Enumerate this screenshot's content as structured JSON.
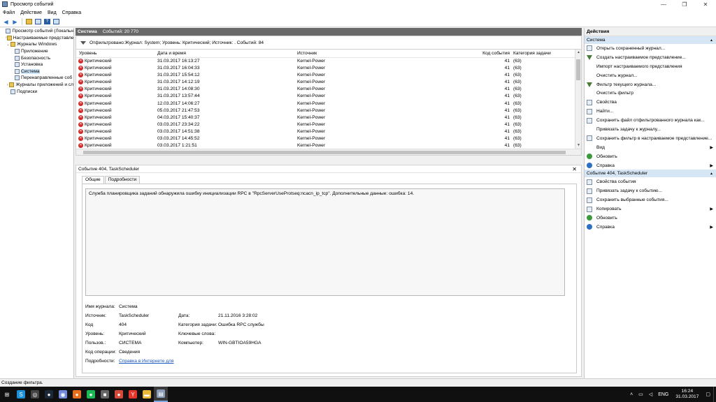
{
  "window": {
    "title": "Просмотр событий",
    "min": "—",
    "max": "❐",
    "close": "✕"
  },
  "menu": [
    "Файл",
    "Действие",
    "Вид",
    "Справка"
  ],
  "tree": [
    {
      "label": "Просмотр событий (Локальн",
      "exp": "",
      "indent": 0,
      "folder": false
    },
    {
      "label": "Настраиваемые представле",
      "exp": "›",
      "indent": 1,
      "folder": true
    },
    {
      "label": "Журналы Windows",
      "exp": "⌄",
      "indent": 1,
      "folder": true
    },
    {
      "label": "Приложение",
      "exp": "",
      "indent": 2,
      "folder": false
    },
    {
      "label": "Безопасность",
      "exp": "",
      "indent": 2,
      "folder": false
    },
    {
      "label": "Установка",
      "exp": "",
      "indent": 2,
      "folder": false
    },
    {
      "label": "Система",
      "exp": "",
      "indent": 2,
      "folder": false,
      "selected": true
    },
    {
      "label": "Перенаправленные соб",
      "exp": "",
      "indent": 2,
      "folder": false
    },
    {
      "label": "Журналы приложений и сл",
      "exp": "›",
      "indent": 1,
      "folder": true
    },
    {
      "label": "Подписки",
      "exp": "",
      "indent": 1,
      "folder": false
    }
  ],
  "center": {
    "log_name": "Система",
    "event_count": "Событий: 20 770",
    "filter_text": "Отфильтровано:Журнал: System; Уровень: Критический; Источник: . Событий: 84",
    "columns": {
      "level": "Уровень",
      "date": "Дата и время",
      "source": "Источник",
      "code": "Код события",
      "category": "Категория задачи"
    },
    "rows": [
      {
        "level": "Критический",
        "date": "31.03.2017 16:13:27",
        "source": "Kernel-Power",
        "code": "41",
        "category": "(63)"
      },
      {
        "level": "Критический",
        "date": "31.03.2017 16:04:33",
        "source": "Kernel-Power",
        "code": "41",
        "category": "(63)"
      },
      {
        "level": "Критический",
        "date": "31.03.2017 15:54:12",
        "source": "Kernel-Power",
        "code": "41",
        "category": "(63)"
      },
      {
        "level": "Критический",
        "date": "31.03.2017 14:12:19",
        "source": "Kernel-Power",
        "code": "41",
        "category": "(63)"
      },
      {
        "level": "Критический",
        "date": "31.03.2017 14:08:30",
        "source": "Kernel-Power",
        "code": "41",
        "category": "(63)"
      },
      {
        "level": "Критический",
        "date": "31.03.2017 13:57:44",
        "source": "Kernel-Power",
        "code": "41",
        "category": "(63)"
      },
      {
        "level": "Критический",
        "date": "12.03.2017 14:06:27",
        "source": "Kernel-Power",
        "code": "41",
        "category": "(63)"
      },
      {
        "level": "Критический",
        "date": "05.03.2017 21:47:53",
        "source": "Kernel-Power",
        "code": "41",
        "category": "(63)"
      },
      {
        "level": "Критический",
        "date": "04.03.2017 15:40:37",
        "source": "Kernel-Power",
        "code": "41",
        "category": "(63)"
      },
      {
        "level": "Критический",
        "date": "03.03.2017 23:34:22",
        "source": "Kernel-Power",
        "code": "41",
        "category": "(63)"
      },
      {
        "level": "Критический",
        "date": "03.03.2017 14:51:38",
        "source": "Kernel-Power",
        "code": "41",
        "category": "(63)"
      },
      {
        "level": "Критический",
        "date": "03.03.2017 14:45:52",
        "source": "Kernel-Power",
        "code": "41",
        "category": "(63)"
      },
      {
        "level": "Критический",
        "date": "03.03.2017 1:21:51",
        "source": "Kernel-Power",
        "code": "41",
        "category": "(63)"
      }
    ]
  },
  "detail": {
    "title": "Событие 404, TaskScheduler",
    "tab_general": "Общие",
    "tab_details": "Подробности",
    "description": "Служба планировщика заданий обнаружила ошибку инициализации RPC в \"RpcServerUseProtseq:ncacn_ip_tcp\". Дополнительные данные: ошибка: 14.",
    "props": {
      "log_name_label": "Имя журнала:",
      "log_name": "Система",
      "source_label": "Источник:",
      "source": "TaskScheduler",
      "date_label": "Дата:",
      "date": "21.11.2016 3:28:02",
      "code_label": "Код",
      "code": "404",
      "category_label": "Категория задачи:",
      "category": "Ошибка RPC службы",
      "level_label": "Уровень:",
      "level": "Критический",
      "keywords_label": "Ключевые слова:",
      "user_label": "Пользов.:",
      "user": "СИСТЕМА",
      "computer_label": "Компьютер:",
      "computer": "WIN-GBTIOA59HGA",
      "opcode_label": "Код операции:",
      "opcode": "Сведения",
      "more_label": "Подробности:",
      "more_link": "Справка в Интернете для"
    }
  },
  "actions": {
    "title": "Действия",
    "section1": "Система",
    "items1": [
      {
        "label": "Открыть сохраненный журнал...",
        "icon": "doc"
      },
      {
        "label": "Создать настраиваемое представление...",
        "icon": "filter"
      },
      {
        "label": "Импорт настраиваемого представления",
        "icon": "none"
      },
      {
        "label": "Очистить журнал...",
        "icon": "none"
      },
      {
        "label": "Фильтр текущего журнала...",
        "icon": "filter"
      },
      {
        "label": "Очистить фильтр",
        "icon": "none"
      },
      {
        "label": "Свойства",
        "icon": "doc"
      },
      {
        "label": "Найти...",
        "icon": "doc"
      },
      {
        "label": "Сохранить файл отфильтрованного журнала как...",
        "icon": "doc"
      },
      {
        "label": "Привязать задачу к журналу...",
        "icon": "none"
      },
      {
        "label": "Сохранить фильтр в настраиваемое представление...",
        "icon": "doc"
      },
      {
        "label": "Вид",
        "icon": "none",
        "sub": true
      },
      {
        "label": "Обновить",
        "icon": "green"
      },
      {
        "label": "Справка",
        "icon": "blue",
        "sub": true
      }
    ],
    "section2": "Событие 404, TaskScheduler",
    "items2": [
      {
        "label": "Свойства события",
        "icon": "doc"
      },
      {
        "label": "Привязать задачу к событию...",
        "icon": "doc"
      },
      {
        "label": "Сохранить выбранные события...",
        "icon": "doc"
      },
      {
        "label": "Копировать",
        "icon": "doc",
        "sub": true
      },
      {
        "label": "Обновить",
        "icon": "green"
      },
      {
        "label": "Справка",
        "icon": "blue",
        "sub": true
      }
    ]
  },
  "status": "Создание фильтра.",
  "taskbar": {
    "apps": [
      {
        "name": "start",
        "glyph": "⊞",
        "color": "#101010"
      },
      {
        "name": "skype",
        "glyph": "S",
        "color": "#1b8fd8"
      },
      {
        "name": "browser",
        "glyph": "◎",
        "color": "#444"
      },
      {
        "name": "steam",
        "glyph": "●",
        "color": "#1b2838"
      },
      {
        "name": "discord",
        "glyph": "◉",
        "color": "#7289da"
      },
      {
        "name": "firefox",
        "glyph": "●",
        "color": "#e76f1c"
      },
      {
        "name": "spotify",
        "glyph": "●",
        "color": "#1db954"
      },
      {
        "name": "app-cube",
        "glyph": "■",
        "color": "#666"
      },
      {
        "name": "chrome",
        "glyph": "●",
        "color": "#d34a3a"
      },
      {
        "name": "yandex",
        "glyph": "Y",
        "color": "#e5352b"
      },
      {
        "name": "explorer",
        "glyph": "▬",
        "color": "#e8b93a"
      },
      {
        "name": "event-viewer",
        "glyph": "▤",
        "color": "#8a9bb5",
        "active": true
      }
    ],
    "lang": "ENG",
    "time": "16:24",
    "date": "31.03.2017"
  }
}
